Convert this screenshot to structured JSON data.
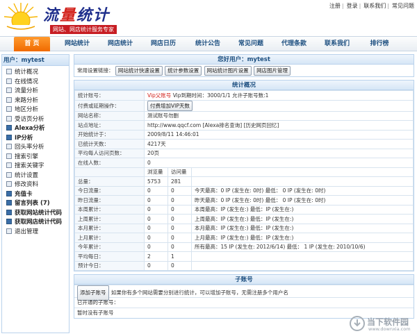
{
  "header": {
    "logo_text_a": "流",
    "logo_text_b": "量",
    "logo_text_c": "统计",
    "slogan": "网站、网店统计服务专家",
    "toplinks": [
      "注册",
      "登录",
      "联系我们",
      "常见问题"
    ]
  },
  "nav": {
    "items": [
      "首 页",
      "网站统计",
      "网店统计",
      "网店日历",
      "统计公告",
      "常见问题",
      "代理条款",
      "联系我们",
      "排行榜"
    ]
  },
  "sidebar": {
    "user": "用户：mytest",
    "items": [
      "统计概况",
      "在线情况",
      "流量分析",
      "来路分析",
      "地区分析",
      "受访页分析",
      "Alexa分析",
      "IP分析",
      "回头率分析",
      "搜索引擎",
      "搜索关键字",
      "统计设置",
      "修改资料",
      "充值卡",
      "留言列表 (7)",
      "获取网站统计代码",
      "获取网店统计代码",
      "退出管理"
    ]
  },
  "welcome": {
    "title": "您好用户：mytest",
    "label": "常用设置链接：",
    "buttons": [
      "网站统计快速设置",
      "统计参数设置",
      "网站统计图片设置",
      "网店图片管理"
    ]
  },
  "overview": {
    "title": "统计概况",
    "account_label": "统计账号：",
    "vip_link": "Vip父账号",
    "vip_info": "Vip到期时间：3000/1/1 允许子账号数:1",
    "renew_label": "付费或延期操作：",
    "renew_button": "付费增加VIP天数",
    "site_name_label": "网站名称：",
    "site_name": "测试账号勿删",
    "site_url_label": "站点地址：",
    "site_url": "http://www.qqcf.com [Alexa排名查询] [历史网页回忆]",
    "start_label": "开始统计于：",
    "start": "2009/8/11 14:46:01",
    "days_label": "已统计天数：",
    "days": "4217天",
    "avg_pages_label": "平均每人访问页数：",
    "avg_pages": "20页",
    "online_label": "在线人数：",
    "online": "0",
    "col_pv": "浏览量",
    "col_uv": "访问量",
    "rows": [
      {
        "label": "总量：",
        "pv": "5753",
        "uv": "281",
        "extra": ""
      },
      {
        "label": "今日流量：",
        "pv": "0",
        "uv": "0",
        "extra": "今天最高：0 IP (发生在: 0时) 最低：  0 IP (发生在: 0时)"
      },
      {
        "label": "昨日流量：",
        "pv": "0",
        "uv": "0",
        "extra": "昨天最高：0 IP (发生在: 0时) 最低：  0 IP (发生在: 0时)"
      },
      {
        "label": "本周累计：",
        "pv": "0",
        "uv": "0",
        "extra": "本周最高：IP (发生在:) 最低：IP (发生在:)"
      },
      {
        "label": "上周累计：",
        "pv": "0",
        "uv": "0",
        "extra": "上周最高：IP (发生在:) 最低：IP (发生在:)"
      },
      {
        "label": "本月累计：",
        "pv": "0",
        "uv": "0",
        "extra": "本月最高：IP (发生在:) 最低：IP (发生在:)"
      },
      {
        "label": "上月累计：",
        "pv": "0",
        "uv": "0",
        "extra": "上月最高：IP (发生在:) 最低：IP (发生在:)"
      },
      {
        "label": "今年累计：",
        "pv": "0",
        "uv": "0",
        "extra": "所有最高：15 IP (发生在: 2012/6/14) 最低：  1 IP (发生在: 2010/10/6)"
      },
      {
        "label": "平均每日：",
        "pv": "2",
        "uv": "1",
        "extra": ""
      },
      {
        "label": "预计今日：",
        "pv": "0",
        "uv": "0",
        "extra": ""
      }
    ]
  },
  "subaccount": {
    "title": "子账号",
    "add_button": "添加子账号",
    "add_hint": "如果你有多个网站需要分别进行统计，可以增加子账号，无需注册多个用户名",
    "opened_label": "已开通的子账号：",
    "none_text": "暂时没有子账号"
  },
  "watermark": {
    "text": "当下软件园",
    "url": "www.downxia.com"
  }
}
